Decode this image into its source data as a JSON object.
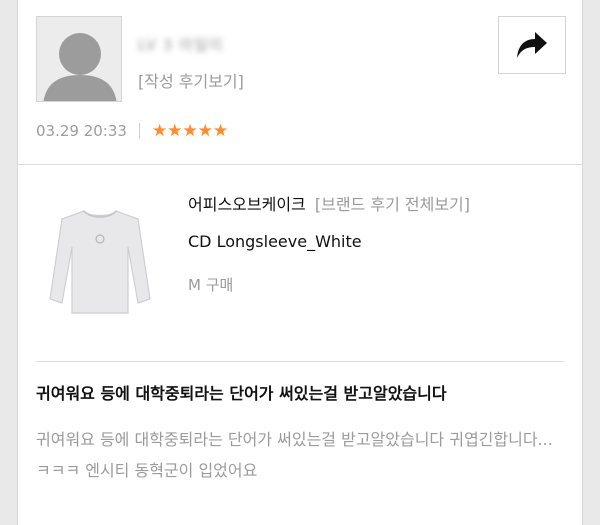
{
  "reviewer": {
    "name": "LV 3 아일이",
    "review_link": "[작성 후기보기]",
    "date": "03.29 20:33",
    "rating": 5,
    "stars": "★★★★★"
  },
  "share": {
    "icon": "share-arrow-icon"
  },
  "product": {
    "brand": "어피스오브케이크",
    "brand_review_link": "[브랜드 후기 전체보기]",
    "name": "CD Longsleeve_White",
    "option": "M 구매",
    "image": "white-longsleeve-shirt"
  },
  "review": {
    "title": "귀여워요 등에 대학중퇴라는 단어가 써있는걸 받고알았습니다",
    "body": "귀여워요 등에 대학중퇴라는 단어가 써있는걸 받고알았습니다 귀엽긴합니다...ㅋㅋㅋ 엔시티 동혁군이 입었어요"
  },
  "colors": {
    "star": "#ff8c2a",
    "muted": "#9b9b9b",
    "text": "#111111"
  }
}
